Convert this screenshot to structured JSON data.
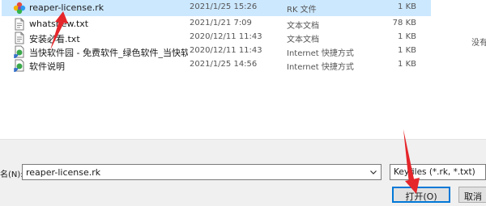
{
  "files": [
    {
      "name": "reaper-license.rk",
      "date": "2021/1/25 15:26",
      "type": "RK 文件",
      "size": "1 KB",
      "icon": "colorful-file-icon",
      "selected": true
    },
    {
      "name": "whatsnew.txt",
      "date": "2021/1/21 7:09",
      "type": "文本文档",
      "size": "78 KB",
      "icon": "text-file-icon"
    },
    {
      "name": "安装必看.txt",
      "date": "2020/12/11 11:43",
      "type": "文本文档",
      "size": "1 KB",
      "icon": "text-file-icon"
    },
    {
      "name": "当快软件园 - 免费软件_绿色软件_当快软...",
      "date": "2020/12/11 11:43",
      "type": "Internet 快捷方式",
      "size": "1 KB",
      "icon": "internet-shortcut-icon"
    },
    {
      "name": "软件说明",
      "date": "2021/1/25 14:56",
      "type": "Internet 快捷方式",
      "size": "1 KB",
      "icon": "internet-shortcut-icon"
    }
  ],
  "side_text": "没有",
  "filename_label": "名(N):",
  "filename_value": "reaper-license.rk",
  "filter_value": "Keyfiles (*.rk, *.txt)",
  "open_label": "打开(O)",
  "cancel_label": "取消",
  "colors": {
    "selection": "#cce8ff",
    "arrow": "#e5262b",
    "button_focus": "#0078d7"
  }
}
